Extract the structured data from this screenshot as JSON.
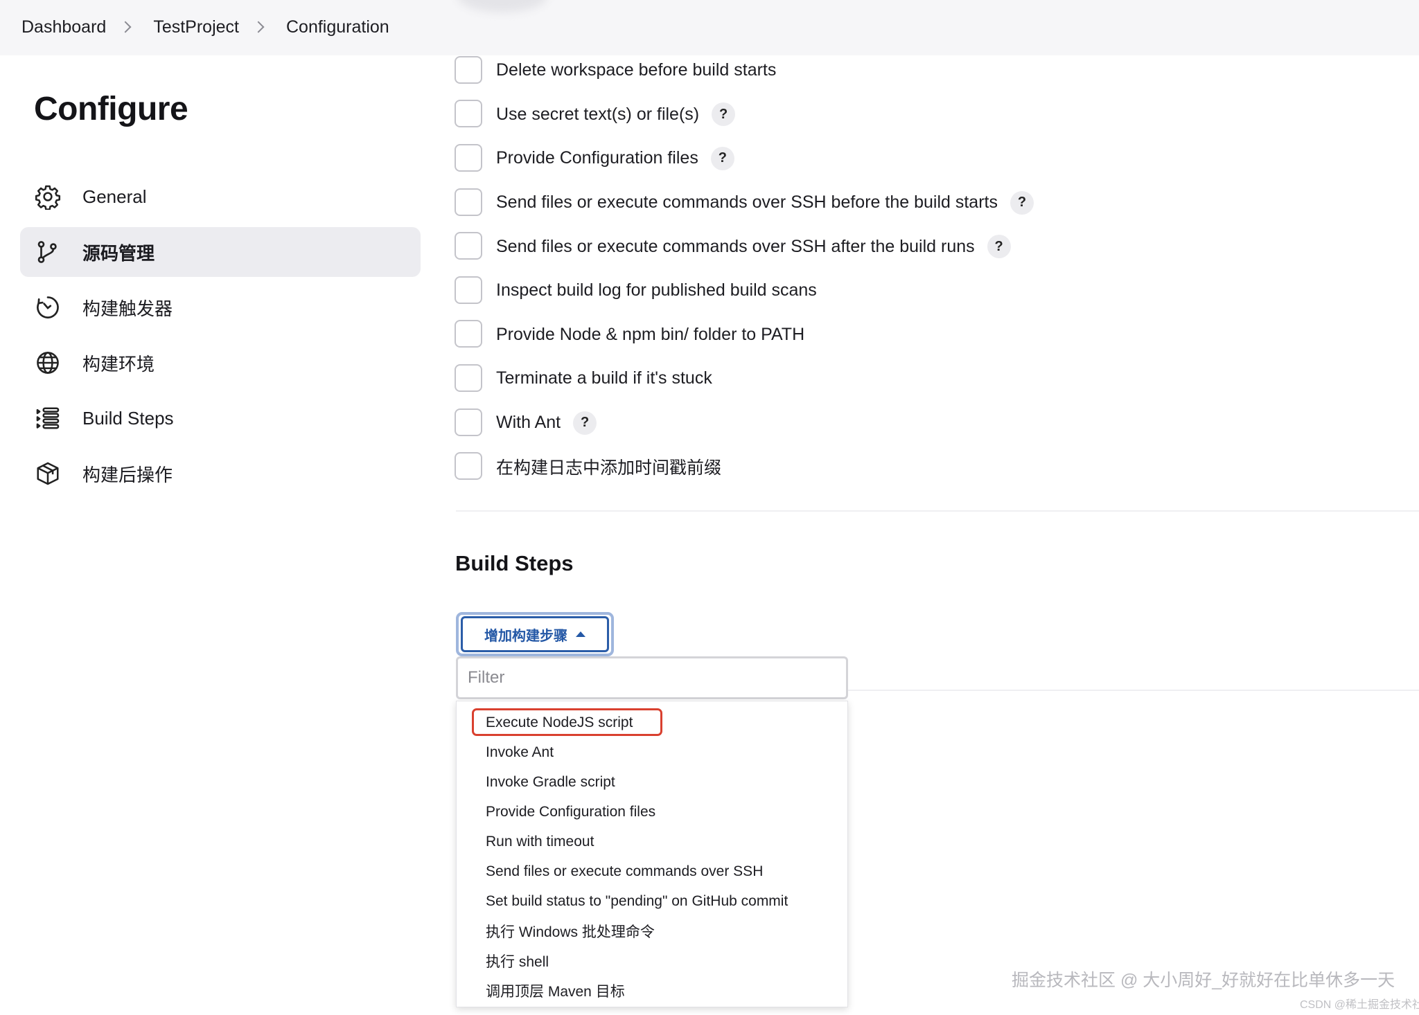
{
  "breadcrumb": {
    "items": [
      "Dashboard",
      "TestProject",
      "Configuration"
    ]
  },
  "page": {
    "title": "Configure"
  },
  "sidebar": {
    "items": [
      {
        "label": "General",
        "icon": "gear-icon",
        "active": false
      },
      {
        "label": "源码管理",
        "icon": "branch-icon",
        "active": true
      },
      {
        "label": "构建触发器",
        "icon": "clock-icon",
        "active": false
      },
      {
        "label": "构建环境",
        "icon": "globe-icon",
        "active": false
      },
      {
        "label": "Build Steps",
        "icon": "list-icon",
        "active": false
      },
      {
        "label": "构建后操作",
        "icon": "cube-icon",
        "active": false
      }
    ]
  },
  "build_environment": {
    "options": [
      {
        "label": "Delete workspace before build starts",
        "help": false
      },
      {
        "label": "Use secret text(s) or file(s)",
        "help": true
      },
      {
        "label": "Provide Configuration files",
        "help": true
      },
      {
        "label": "Send files or execute commands over SSH before the build starts",
        "help": true
      },
      {
        "label": "Send files or execute commands over SSH after the build runs",
        "help": true
      },
      {
        "label": "Inspect build log for published build scans",
        "help": false
      },
      {
        "label": "Provide Node & npm bin/ folder to PATH",
        "help": false
      },
      {
        "label": "Terminate a build if it's stuck",
        "help": false
      },
      {
        "label": "With Ant",
        "help": true
      },
      {
        "label": "在构建日志中添加时间戳前缀",
        "help": false
      }
    ],
    "help_glyph": "?"
  },
  "build_steps": {
    "title": "Build Steps",
    "add_button_label": "增加构建步骤",
    "filter_placeholder": "Filter",
    "menu_items": [
      "Execute NodeJS script",
      "Invoke Ant",
      "Invoke Gradle script",
      "Provide Configuration files",
      "Run with timeout",
      "Send files or execute commands over SSH",
      "Set build status to \"pending\" on GitHub commit",
      "执行 Windows 批处理命令",
      "执行 shell",
      "调用顶层 Maven 目标"
    ],
    "highlighted_index": 0
  },
  "watermark": {
    "text": "掘金技术社区 @ 大小周好_好就好在比单休多一天",
    "sub": "CSDN @稀土掘金技术社区"
  },
  "colors": {
    "accent": "#2458a6",
    "highlight": "#d9402f",
    "active_nav": "#ececf0"
  }
}
